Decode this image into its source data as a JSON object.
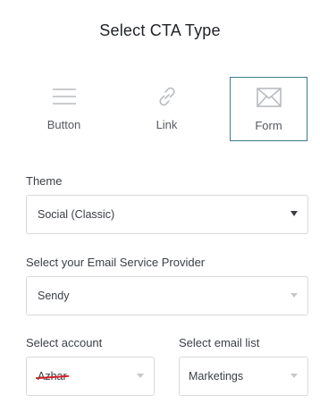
{
  "title": "Select CTA Type",
  "cta_types": [
    {
      "label": "Button",
      "icon": "menu-lines-icon",
      "selected": false
    },
    {
      "label": "Link",
      "icon": "link-icon",
      "selected": false
    },
    {
      "label": "Form",
      "icon": "envelope-icon",
      "selected": true
    }
  ],
  "theme": {
    "label": "Theme",
    "value": "Social (Classic)"
  },
  "provider": {
    "label": "Select your Email Service Provider",
    "value": "Sendy"
  },
  "account": {
    "label": "Select account",
    "value": "Azhar"
  },
  "email_list": {
    "label": "Select email list",
    "value": "Marketings"
  },
  "colors": {
    "accent": "#3b7d8a",
    "icon_gray": "#b8bbbf",
    "strike_red": "#d0232a"
  }
}
